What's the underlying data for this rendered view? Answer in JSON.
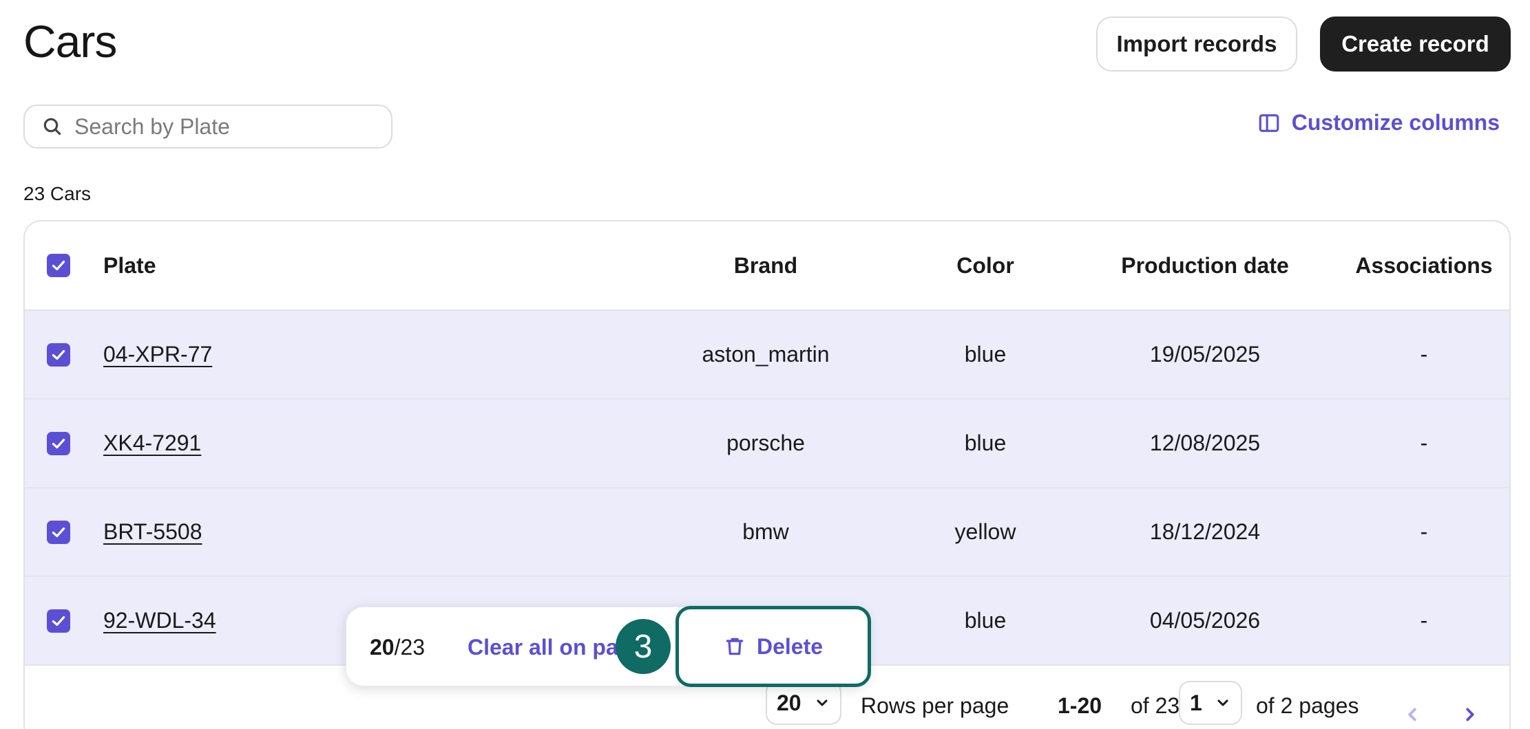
{
  "header": {
    "title": "Cars",
    "import_label": "Import records",
    "create_label": "Create record"
  },
  "search": {
    "placeholder": "Search by Plate",
    "value": ""
  },
  "customize_label": "Customize columns",
  "record_count": "23 Cars",
  "table": {
    "columns": [
      "Plate",
      "Brand",
      "Color",
      "Production date",
      "Associations"
    ],
    "rows": [
      {
        "plate": "04-XPR-77",
        "brand": "aston_martin",
        "color": "blue",
        "date": "19/05/2025",
        "assoc": "-",
        "selected": true
      },
      {
        "plate": "XK4-7291",
        "brand": "porsche",
        "color": "blue",
        "date": "12/08/2025",
        "assoc": "-",
        "selected": true
      },
      {
        "plate": "BRT-5508",
        "brand": "bmw",
        "color": "yellow",
        "date": "18/12/2024",
        "assoc": "-",
        "selected": true
      },
      {
        "plate": "92-WDL-34",
        "brand": "",
        "color": "blue",
        "date": "04/05/2026",
        "assoc": "-",
        "selected": true
      }
    ]
  },
  "pagination": {
    "rows_per_page_value": "20",
    "rows_per_page_label": "Rows per page",
    "range": "1-20",
    "of_total": "of 23",
    "page_value": "1",
    "of_pages": "of 2 pages"
  },
  "bulk_bar": {
    "selected": "20",
    "total": "/23",
    "clear_label": "Clear all on page",
    "delete_label": "Delete"
  },
  "step_badge": "3",
  "colors": {
    "accent": "#5b4fd6",
    "selected_row": "#edecfb",
    "highlight": "#0f6b63"
  },
  "icons": [
    "search-icon",
    "columns-icon",
    "checkbox-checked-icon",
    "chevron-down-icon",
    "chevron-left-icon",
    "chevron-right-icon",
    "trash-icon"
  ]
}
